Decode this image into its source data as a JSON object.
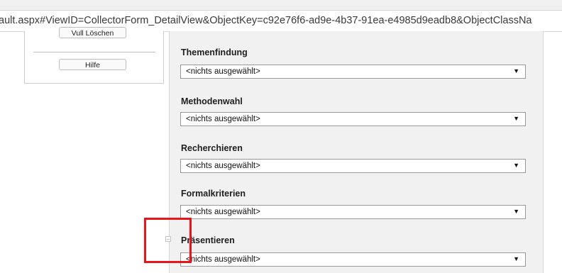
{
  "browser": {
    "url": "ault.aspx#ViewID=CollectorForm_DetailView&ObjectKey=c92e76f6-ad9e-4b37-91ea-e4985d9eadb8&ObjectClassNa"
  },
  "sidebar": {
    "cut_button_label": "Vull Löschen",
    "help_button_label": "Hilfe"
  },
  "form": {
    "fields": [
      {
        "label": "Themenfindung",
        "value": "<nichts ausgewählt>"
      },
      {
        "label": "Methodenwahl",
        "value": "<nichts ausgewählt>"
      },
      {
        "label": "Recherchieren",
        "value": "<nichts ausgewählt>"
      },
      {
        "label": "Formalkriterien",
        "value": "<nichts ausgewählt>"
      },
      {
        "label": "Präsentieren",
        "value": "<nichts ausgewählt>"
      }
    ]
  },
  "colors": {
    "highlight": "#e8161b",
    "panel_background": "#f1f1f1"
  },
  "icons": {
    "dropdown": "dropdown-arrow-icon",
    "collapse": "collapse-icon"
  }
}
